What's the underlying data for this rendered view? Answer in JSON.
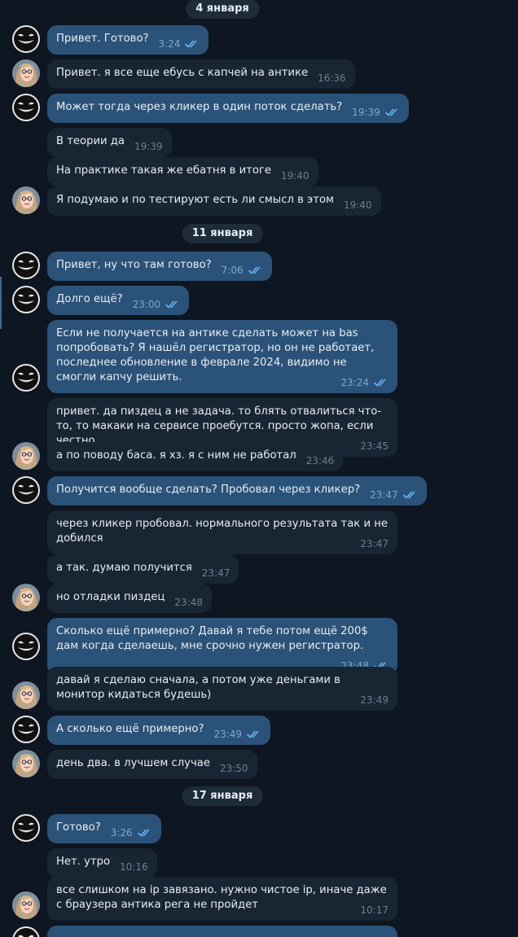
{
  "conversation": {
    "dates": {
      "jan4": "4 января",
      "jan11": "11 января",
      "jan17": "17 января"
    },
    "messages": [
      {
        "text": "Привет. Готово?",
        "time": "3:24"
      },
      {
        "text": "Привет. я все еще ебусь с капчей на антике",
        "time": "16:36"
      },
      {
        "text": "Может тогда через кликер в один поток сделать?",
        "time": "19:39"
      },
      {
        "text": "В теории да",
        "time": "19:39"
      },
      {
        "text": "На практике такая же ебатня в итоге",
        "time": "19:40"
      },
      {
        "text": "Я подумаю и по тестируют есть ли смысл в этом",
        "time": "19:40"
      },
      {
        "text": "Привет, ну что там готово?",
        "time": "7:06"
      },
      {
        "text": "Долго ещё?",
        "time": "23:00"
      },
      {
        "text": "Если не получается на антике сделать может на bas попробовать? Я нашёл регистратор, но он не работает, последнее обновление в феврале 2024, видимо не смогли капчу решить.",
        "time": "23:24"
      },
      {
        "text": "привет. да пиздец а не задача. то блять отвалиться что-то, то макаки на сервисе проебутся. просто жопа, если честно",
        "time": "23:45"
      },
      {
        "text": "а по поводу баса. я хз. я с ним не работал",
        "time": "23:46"
      },
      {
        "text": "Получится вообще сделать? Пробовал через кликер?",
        "time": "23:47"
      },
      {
        "text": "через кликер пробовал. нормального результата так и не добился",
        "time": "23:47"
      },
      {
        "text": "а так. думаю получится",
        "time": "23:47"
      },
      {
        "text": "но отладки пиздец",
        "time": "23:48"
      },
      {
        "text": "Сколько ещё примерно? Давай я тебе потом ещё 200$ дам когда сделаешь, мне срочно нужен регистратор.",
        "time": "23:48"
      },
      {
        "text": "давай я сделаю сначала, а потом уже деньгами в монитор кидаться будешь)",
        "time": "23:49"
      },
      {
        "text": "А сколько ещё примерно?",
        "time": "23:49"
      },
      {
        "text": "день два. в лучшем случае",
        "time": "23:50"
      },
      {
        "text": "Готово?",
        "time": "3:26"
      },
      {
        "text": "Нет. утро",
        "time": "10:16"
      },
      {
        "text": "все слишком на ip завязано. нужно чистое ip, иначе даже с браузера антика рега не пройдет",
        "time": "10:17"
      }
    ]
  },
  "colors": {
    "background": "#0e1621",
    "incoming_bubble": "#182533",
    "outgoing_bubble": "#2b5278",
    "date_pill": "#1e2c3a",
    "read_checks": "#64b5f6"
  },
  "icons": {
    "read_receipt": "double-check-icon",
    "contact_avatar": "grin-mask-avatar",
    "user_avatar": "girl-portrait-avatar"
  }
}
